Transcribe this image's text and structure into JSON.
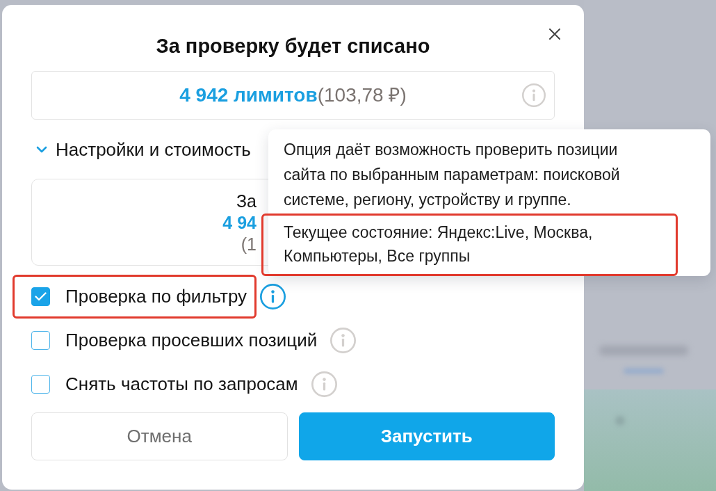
{
  "dialog": {
    "title": "За проверку будет списано",
    "cost": {
      "limits": "4 942 лимитов",
      "price": "(103,78 ₽)"
    },
    "settings_toggle": {
      "label": "Настройки и стоимость",
      "expanded": true
    },
    "summary_card": {
      "lines": [
        {
          "text": "За",
          "kind": "plain"
        },
        {
          "text": "4 94",
          "kind": "accent"
        },
        {
          "text": "(1",
          "kind": "muted"
        }
      ]
    },
    "options": [
      {
        "label": "Проверка по фильтру",
        "checked": true,
        "highlighted": true,
        "info_active": true
      },
      {
        "label": "Проверка просевших позиций",
        "checked": false,
        "highlighted": false,
        "info_active": false
      },
      {
        "label": "Снять частоты по запросам",
        "checked": false,
        "highlighted": false,
        "info_active": false
      }
    ],
    "buttons": [
      {
        "label": "Отмена",
        "kind": "secondary"
      },
      {
        "label": "Запустить",
        "kind": "primary"
      }
    ]
  },
  "tooltip": {
    "paragraphs": [
      {
        "text": "Опция даёт возможность проверить позиции сайта по выбранным параметрам: поисковой системе, региону, устройству и группе.",
        "highlighted": false
      },
      {
        "text": "Текущее состояние: Яндекс:Live, Москва, Компьютеры, Все группы",
        "highlighted": true
      }
    ]
  }
}
